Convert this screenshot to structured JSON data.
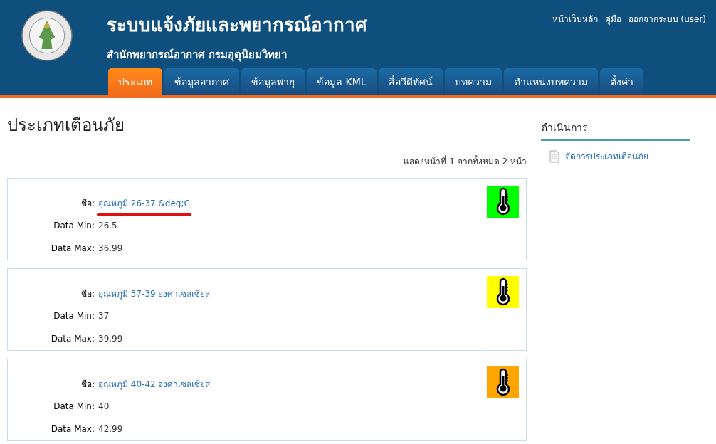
{
  "header": {
    "title": "ระบบแจ้งภัยและพยากรณ์อากาศ",
    "subtitle": "สำนักพยากรณ์อากาศ กรมอุตุนิยมวิทยา",
    "links": [
      "หน้าเว็บหลัก",
      "คู่มือ",
      "ออกจากระบบ (user)"
    ]
  },
  "tabs": [
    {
      "label": "ประเภท",
      "selected": true
    },
    {
      "label": "ข้อมูลอากาศ",
      "selected": false
    },
    {
      "label": "ข้อมูลพายุ",
      "selected": false
    },
    {
      "label": "ข้อมูล KML",
      "selected": false
    },
    {
      "label": "สื่อวีดีทัศน์",
      "selected": false
    },
    {
      "label": "บทความ",
      "selected": false
    },
    {
      "label": "ตำแหน่งบทความ",
      "selected": false
    },
    {
      "label": "ตั้งค่า",
      "selected": false
    }
  ],
  "page_title": "ประเภทเตือนภัย",
  "pager": "แสดงหน้าที่ 1 จากทั้งหมด 2 หน้า",
  "items": [
    {
      "name_label": "ชื่อ:",
      "name": "อุณหภูมิ 26-37 &deg;C",
      "underlined": true,
      "min_label": "Data Min:",
      "min": "26.5",
      "max_label": "Data Max:",
      "max": "36.99",
      "color": "#00ff00"
    },
    {
      "name_label": "ชื่อ:",
      "name": "อุณหภูมิ 37-39 องศาเซลเซียส",
      "underlined": false,
      "min_label": "Data Min:",
      "min": "37",
      "max_label": "Data Max:",
      "max": "39.99",
      "color": "#ffff00"
    },
    {
      "name_label": "ชื่อ:",
      "name": "อุณหภูมิ 40-42 องศาเซลเซียส",
      "underlined": false,
      "min_label": "Data Min:",
      "min": "40",
      "max_label": "Data Max:",
      "max": "42.99",
      "color": "#ffa500"
    }
  ],
  "sidebar": {
    "title": "ดำเนินการ",
    "items": [
      "จัดการประเภทเตือนภัย"
    ]
  }
}
